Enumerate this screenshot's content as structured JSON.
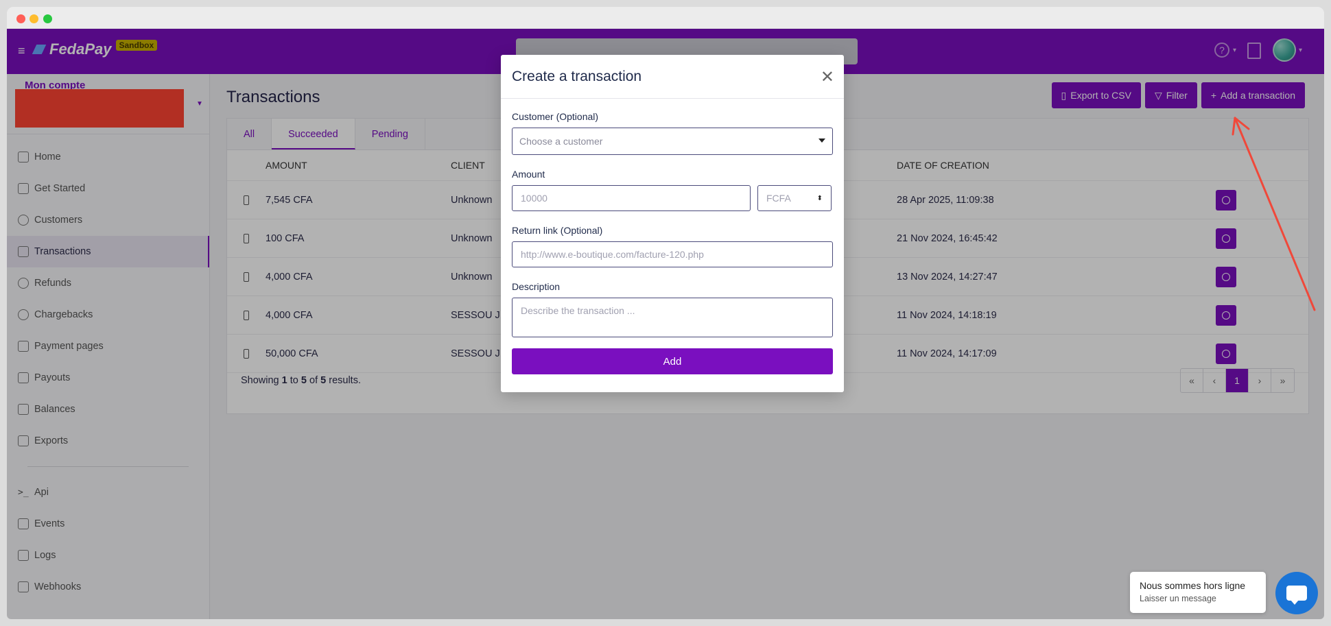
{
  "brand": {
    "name": "FedaPay",
    "env_badge": "Sandbox"
  },
  "sidebar": {
    "account_label": "Mon compte",
    "items": [
      {
        "label": "Home",
        "icon": "home-icon"
      },
      {
        "label": "Get Started",
        "icon": "flag-icon"
      },
      {
        "label": "Customers",
        "icon": "user-circle-icon"
      },
      {
        "label": "Transactions",
        "icon": "money-icon"
      },
      {
        "label": "Refunds",
        "icon": "refund-icon"
      },
      {
        "label": "Chargebacks",
        "icon": "info-icon"
      },
      {
        "label": "Payment pages",
        "icon": "file-icon"
      },
      {
        "label": "Payouts",
        "icon": "payout-icon"
      },
      {
        "label": "Balances",
        "icon": "scale-icon"
      },
      {
        "label": "Exports",
        "icon": "download-icon"
      }
    ],
    "dev_items": [
      {
        "label": "Api",
        "icon": "terminal-icon"
      },
      {
        "label": "Events",
        "icon": "events-icon"
      },
      {
        "label": "Logs",
        "icon": "logs-icon"
      },
      {
        "label": "Webhooks",
        "icon": "webhook-icon"
      }
    ]
  },
  "main": {
    "title": "Transactions",
    "actions": {
      "export": "Export to CSV",
      "filter": "Filter",
      "add": "Add a transaction"
    },
    "tabs": [
      "All",
      "Succeeded",
      "Pending"
    ],
    "active_tab": "Succeeded",
    "columns": {
      "amount": "AMOUNT",
      "client": "CLIENT",
      "date": "DATE OF CREATION"
    },
    "rows": [
      {
        "amount": "7,545 CFA",
        "client": "Unknown",
        "date": "28 Apr 2025, 11:09:38"
      },
      {
        "amount": "100 CFA",
        "client": "Unknown",
        "date": "21 Nov 2024, 16:45:42"
      },
      {
        "amount": "4,000 CFA",
        "client": "Unknown",
        "date": "13 Nov 2024, 14:27:47"
      },
      {
        "amount": "4,000 CFA",
        "client": "SESSOU J",
        "date": "11 Nov 2024, 14:18:19"
      },
      {
        "amount": "50,000 CFA",
        "client": "SESSOU J",
        "date": "11 Nov 2024, 14:17:09"
      }
    ],
    "footer": {
      "prefix": "Showing",
      "from": "1",
      "to_word": "to",
      "to": "5",
      "of_word": "of",
      "total": "5",
      "suffix": "results."
    },
    "pager": [
      "«",
      "‹",
      "1",
      "›",
      "»"
    ]
  },
  "modal": {
    "title": "Create a transaction",
    "customer_label": "Customer (Optional)",
    "customer_placeholder": "Choose a customer",
    "amount_label": "Amount",
    "amount_placeholder": "10000",
    "currency": "FCFA",
    "return_label": "Return link (Optional)",
    "return_placeholder": "http://www.e-boutique.com/facture-120.php",
    "description_label": "Description",
    "description_placeholder": "Describe the transaction ...",
    "submit": "Add"
  },
  "chat": {
    "title": "Nous sommes hors ligne",
    "subtitle": "Laisser un message"
  },
  "colors": {
    "brand": "#7a0fbf",
    "annotation_arrow": "#f0483a",
    "chat": "#1a74d6"
  }
}
